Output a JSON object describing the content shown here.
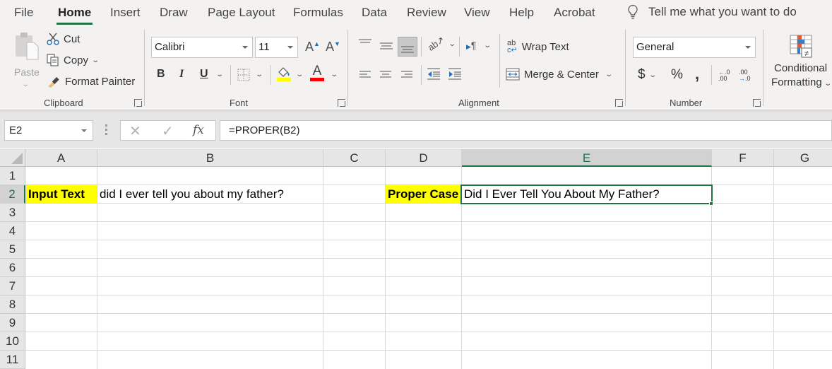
{
  "menu": {
    "tabs": [
      "File",
      "Home",
      "Insert",
      "Draw",
      "Page Layout",
      "Formulas",
      "Data",
      "Review",
      "View",
      "Help",
      "Acrobat"
    ],
    "active_tab": "Home",
    "tell_me": "Tell me what you want to do"
  },
  "ribbon": {
    "clipboard": {
      "label": "Clipboard",
      "paste": "Paste",
      "cut": "Cut",
      "copy": "Copy",
      "format_painter": "Format Painter"
    },
    "font": {
      "label": "Font",
      "font_name": "Calibri",
      "font_size": "11",
      "bold": "B",
      "italic": "I",
      "underline": "U",
      "grow": "A",
      "shrink": "A",
      "font_color_letter": "A",
      "highlight_color": "#ffff00",
      "font_color": "#ff0000"
    },
    "alignment": {
      "label": "Alignment",
      "wrap_text": "Wrap Text",
      "merge_center": "Merge & Center"
    },
    "number": {
      "label": "Number",
      "format": "General",
      "currency": "$",
      "percent": "%",
      "comma": ","
    },
    "styles": {
      "conditional_formatting_line1": "Conditional",
      "conditional_formatting_line2": "Formatting"
    }
  },
  "formula_bar": {
    "name_box": "E2",
    "formula": "=PROPER(B2)",
    "cancel": "✕",
    "enter": "✓",
    "fx": "fx"
  },
  "sheet": {
    "columns": [
      "A",
      "B",
      "C",
      "D",
      "E",
      "F",
      "G"
    ],
    "selected_column": "E",
    "rows": [
      "1",
      "2",
      "3",
      "4",
      "5",
      "6",
      "7",
      "8",
      "9",
      "10",
      "11"
    ],
    "selected_row": "2",
    "active_cell": "E2",
    "cells": {
      "A2": "Input Text",
      "B2": "did I ever tell you about my father?",
      "D2": "Proper Case",
      "E2": "Did I Ever Tell You About My Father?"
    },
    "highlight_color": "#ffff00",
    "accent_color": "#217346"
  }
}
